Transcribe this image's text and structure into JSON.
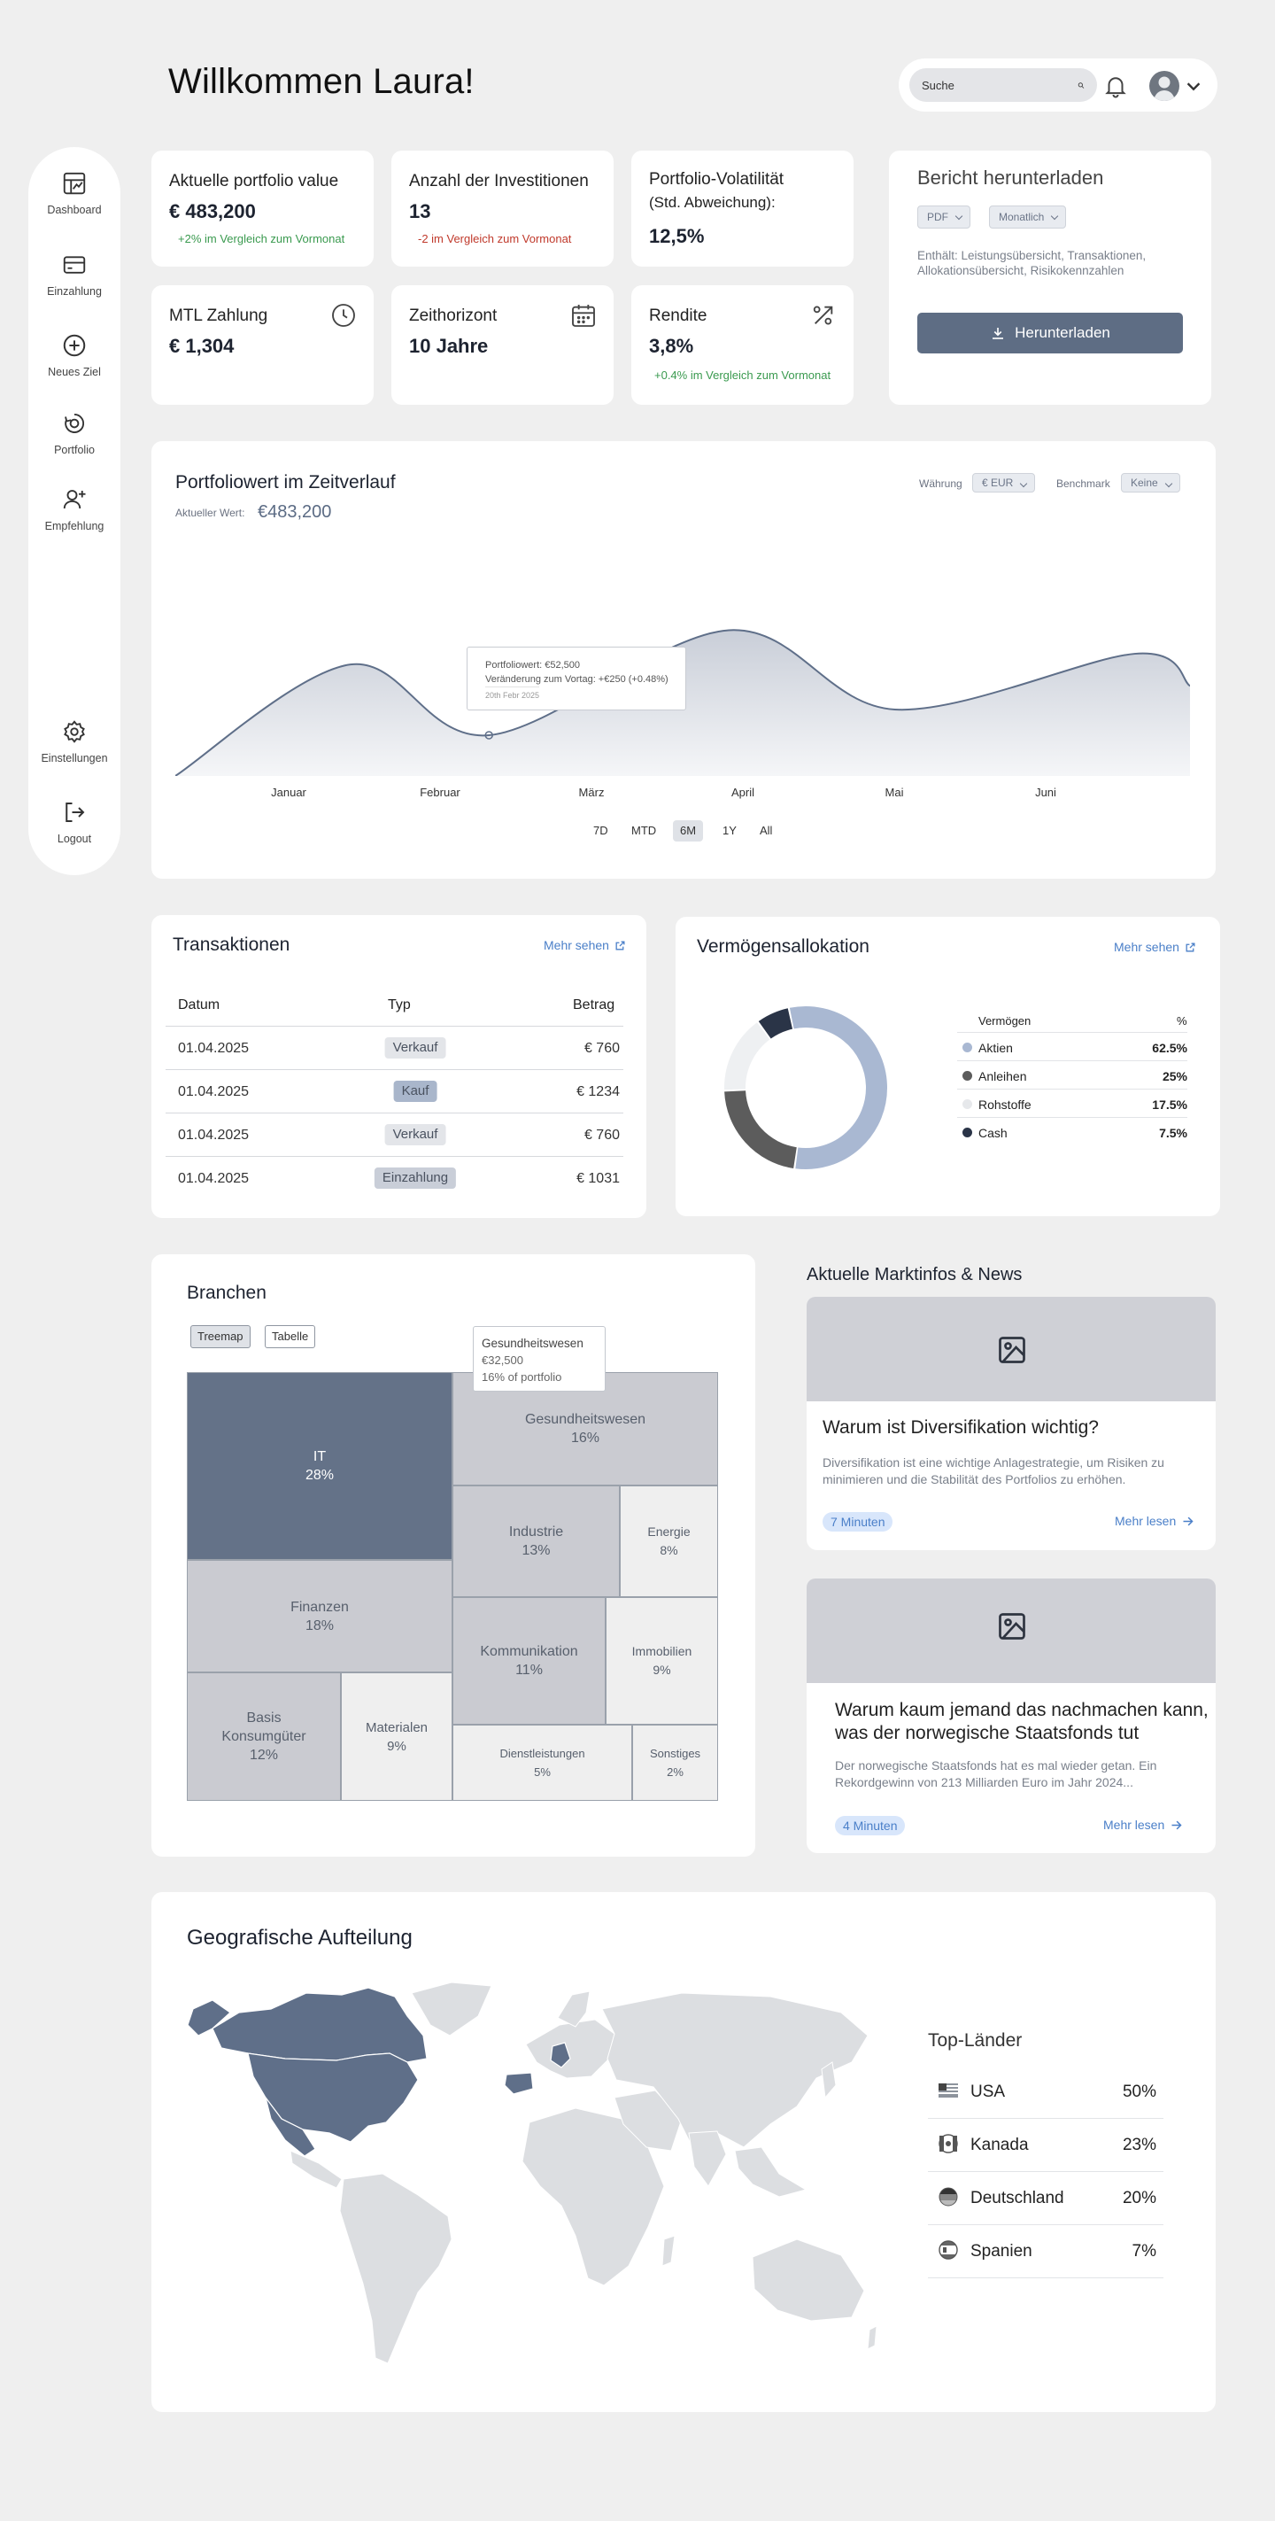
{
  "header": {
    "welcome": "Willkommen Laura!",
    "search_placeholder": "Suche"
  },
  "sidebar": {
    "items": [
      {
        "label": "Dashboard",
        "icon": "dashboard-icon"
      },
      {
        "label": "Einzahlung",
        "icon": "card-icon"
      },
      {
        "label": "Neues Ziel",
        "icon": "plus-circle-icon"
      },
      {
        "label": "Portfolio",
        "icon": "portfolio-icon"
      },
      {
        "label": "Empfehlung",
        "icon": "user-plus-icon"
      }
    ],
    "bottom": [
      {
        "label": "Einstellungen",
        "icon": "settings-icon"
      },
      {
        "label": "Logout",
        "icon": "logout-icon"
      }
    ]
  },
  "kpis": {
    "portfolio_value": {
      "title": "Aktuelle portfolio value",
      "value": "€ 483,200",
      "delta": "+2% im Vergleich zum Vormonat"
    },
    "investitionen": {
      "title": "Anzahl der Investitionen",
      "value": "13",
      "delta": "-2 im Vergleich zum Vormonat"
    },
    "volatilitaet": {
      "title": "Portfolio-Volatilität",
      "subtitle": "(Std. Abweichung):",
      "value": "12,5%"
    },
    "mtl": {
      "title": "MTL Zahlung",
      "value": "€ 1,304"
    },
    "zeithorizont": {
      "title": "Zeithorizont",
      "value": "10 Jahre"
    },
    "rendite": {
      "title": "Rendite",
      "value": "3,8%",
      "delta": "+0.4% im Vergleich zum Vormonat"
    }
  },
  "report": {
    "title": "Bericht herunterladen",
    "format": "PDF",
    "period": "Monatlich",
    "contents": "Enthält: Leistungsübersicht, Transaktionen, Allokationsübersicht, Risikokennzahlen",
    "button": "Herunterladen"
  },
  "portfolio_chart": {
    "title": "Portfoliowert im Zeitverlauf",
    "current_label": "Aktueller Wert:",
    "current_value": "€483,200",
    "currency_label": "Währung",
    "currency": "€ EUR",
    "benchmark_label": "Benchmark",
    "benchmark": "Keine",
    "tooltip": {
      "line1": "Portfoliowert: €52,500",
      "line2": "Veränderung zum Vortag: +€250 (+0.48%)",
      "line3": "20th Febr 2025"
    },
    "ranges": [
      "7D",
      "MTD",
      "6M",
      "1Y",
      "All"
    ],
    "active_range": "6M"
  },
  "chart_data": {
    "type": "area",
    "categories": [
      "Januar",
      "Februar",
      "März",
      "April",
      "Mai",
      "Juni"
    ],
    "points": [
      {
        "x": 0.0,
        "y": 0.0
      },
      {
        "x": 0.95,
        "y": 0.52
      },
      {
        "x": 1.7,
        "y": 0.19
      },
      {
        "x": 3.0,
        "y": 0.68
      },
      {
        "x": 3.9,
        "y": 0.31
      },
      {
        "x": 5.2,
        "y": 0.57
      },
      {
        "x": 5.5,
        "y": 0.42
      }
    ],
    "ylim": [
      0,
      1
    ]
  },
  "transactions": {
    "title": "Transaktionen",
    "more": "Mehr sehen",
    "columns": [
      "Datum",
      "Typ",
      "Betrag"
    ],
    "rows": [
      {
        "date": "01.04.2025",
        "type": "Verkauf",
        "amount": "€ 760"
      },
      {
        "date": "01.04.2025",
        "type": "Kauf",
        "amount": "€ 1234"
      },
      {
        "date": "01.04.2025",
        "type": "Verkauf",
        "amount": "€ 760"
      },
      {
        "date": "01.04.2025",
        "type": "Einzahlung",
        "amount": "€ 1031"
      }
    ]
  },
  "allocation": {
    "title": "Vermögensallokation",
    "more": "Mehr sehen",
    "col_asset": "Vermögen",
    "col_pct": "%",
    "items": [
      {
        "name": "Aktien",
        "pct": "62.5%",
        "value": 62.5,
        "color": "#a9b8d2"
      },
      {
        "name": "Anleihen",
        "pct": "25%",
        "value": 25,
        "color": "#5c5c5c"
      },
      {
        "name": "Rohstoffe",
        "pct": "17.5%",
        "value": 17.5,
        "color": "#eef0f2"
      },
      {
        "name": "Cash",
        "pct": "7.5%",
        "value": 7.5,
        "color": "#2a3447"
      }
    ]
  },
  "sectors": {
    "title": "Branchen",
    "toggle_treemap": "Treemap",
    "toggle_table": "Tabelle",
    "tooltip": {
      "name": "Gesundheitswesen",
      "value": "€32,500",
      "share": "16% of portfolio"
    },
    "items": [
      {
        "name": "IT",
        "pct": "28%"
      },
      {
        "name": "Gesundheitswesen",
        "pct": "16%"
      },
      {
        "name": "Finanzen",
        "pct": "18%"
      },
      {
        "name": "Industrie",
        "pct": "13%"
      },
      {
        "name": "Energie",
        "pct": "8%"
      },
      {
        "name": "Kommunikation",
        "pct": "11%"
      },
      {
        "name": "Immobilien",
        "pct": "9%"
      },
      {
        "name": "Basis Konsumgüter",
        "pct": "12%"
      },
      {
        "name": "Materialen",
        "pct": "9%"
      },
      {
        "name": "Dienstleistungen",
        "pct": "5%"
      },
      {
        "name": "Sonstiges",
        "pct": "2%"
      }
    ]
  },
  "news": {
    "title": "Aktuelle Marktinfos & News",
    "items": [
      {
        "title": "Warum ist Diversifikation wichtig?",
        "text": "Diversifikation ist eine wichtige Anlagestrategie, um Risiken zu minimieren und die Stabilität des Portfolios zu erhöhen.",
        "duration": "7 Minuten",
        "more": "Mehr lesen"
      },
      {
        "title": "Warum kaum jemand das nachmachen kann, was der norwegische Staatsfonds tut",
        "text": "Der norwegische Staatsfonds hat es mal wieder getan. Ein Rekordgewinn von 213 Milliarden Euro im Jahr 2024...",
        "duration": "4 Minuten",
        "more": "Mehr lesen"
      }
    ]
  },
  "geo": {
    "title": "Geografische Aufteilung",
    "top_title": "Top-Länder",
    "countries": [
      {
        "name": "USA",
        "pct": "50%"
      },
      {
        "name": "Kanada",
        "pct": "23%"
      },
      {
        "name": "Deutschland",
        "pct": "20%"
      },
      {
        "name": "Spanien",
        "pct": "7%"
      }
    ]
  }
}
